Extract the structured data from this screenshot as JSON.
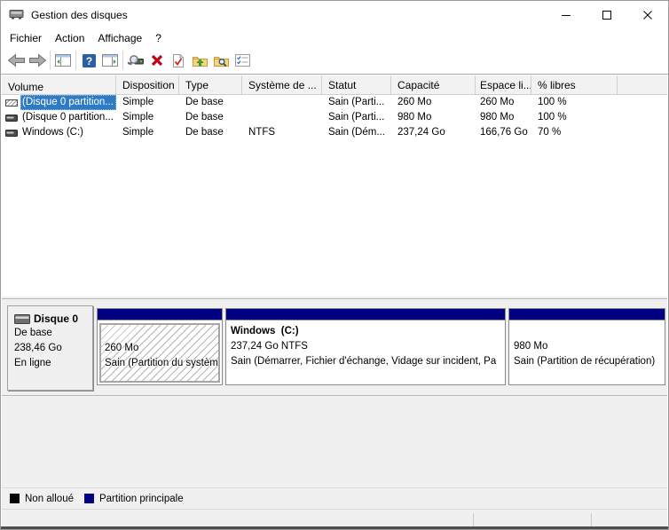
{
  "window": {
    "title": "Gestion des disques",
    "controls": {
      "minimize": "minimize",
      "maximize": "maximize",
      "close": "close"
    }
  },
  "menu": {
    "items": [
      {
        "label": "Fichier"
      },
      {
        "label": "Action"
      },
      {
        "label": "Affichage"
      },
      {
        "label": "?"
      }
    ]
  },
  "toolbar": {
    "icons": [
      "back",
      "forward",
      "show-console-tree",
      "help",
      "show-action-pane",
      "inspect-disk",
      "delete-volume",
      "check-task",
      "folder-up",
      "folder-explore",
      "task-list"
    ]
  },
  "table": {
    "columns": [
      "Volume",
      "Disposition",
      "Type",
      "Système de ...",
      "Statut",
      "Capacité",
      "Espace li...",
      "% libres"
    ],
    "rows": [
      {
        "volume": "(Disque 0 partition...",
        "disposition": "Simple",
        "type": "De base",
        "fs": "",
        "statut": "Sain (Parti...",
        "capacite": "260 Mo",
        "espace": "260 Mo",
        "libres": "100 %"
      },
      {
        "volume": "(Disque 0 partition...",
        "disposition": "Simple",
        "type": "De base",
        "fs": "",
        "statut": "Sain (Parti...",
        "capacite": "980 Mo",
        "espace": "980 Mo",
        "libres": "100 %"
      },
      {
        "volume": "Windows (C:)",
        "disposition": "Simple",
        "type": "De base",
        "fs": "NTFS",
        "statut": "Sain (Dém...",
        "capacite": "237,24 Go",
        "espace": "166,76 Go",
        "libres": "70 %"
      }
    ]
  },
  "disk": {
    "name": "Disque 0",
    "type": "De base",
    "size": "238,46 Go",
    "status": "En ligne",
    "partitions": [
      {
        "name": "",
        "size": "260 Mo",
        "status": "Sain (Partition du système EFI)"
      },
      {
        "name": "Windows  (C:)",
        "size": "237,24 Go NTFS",
        "status": "Sain (Démarrer, Fichier d'échange, Vidage sur incident, Pa"
      },
      {
        "name": "",
        "size": "980 Mo",
        "status": "Sain (Partition de récupération)"
      }
    ]
  },
  "legend": {
    "items": [
      {
        "label": "Non alloué",
        "color": "#000000"
      },
      {
        "label": "Partition principale",
        "color": "#000080"
      }
    ]
  },
  "colors": {
    "selection": "#2e7bc4",
    "partition_band": "#000080"
  }
}
